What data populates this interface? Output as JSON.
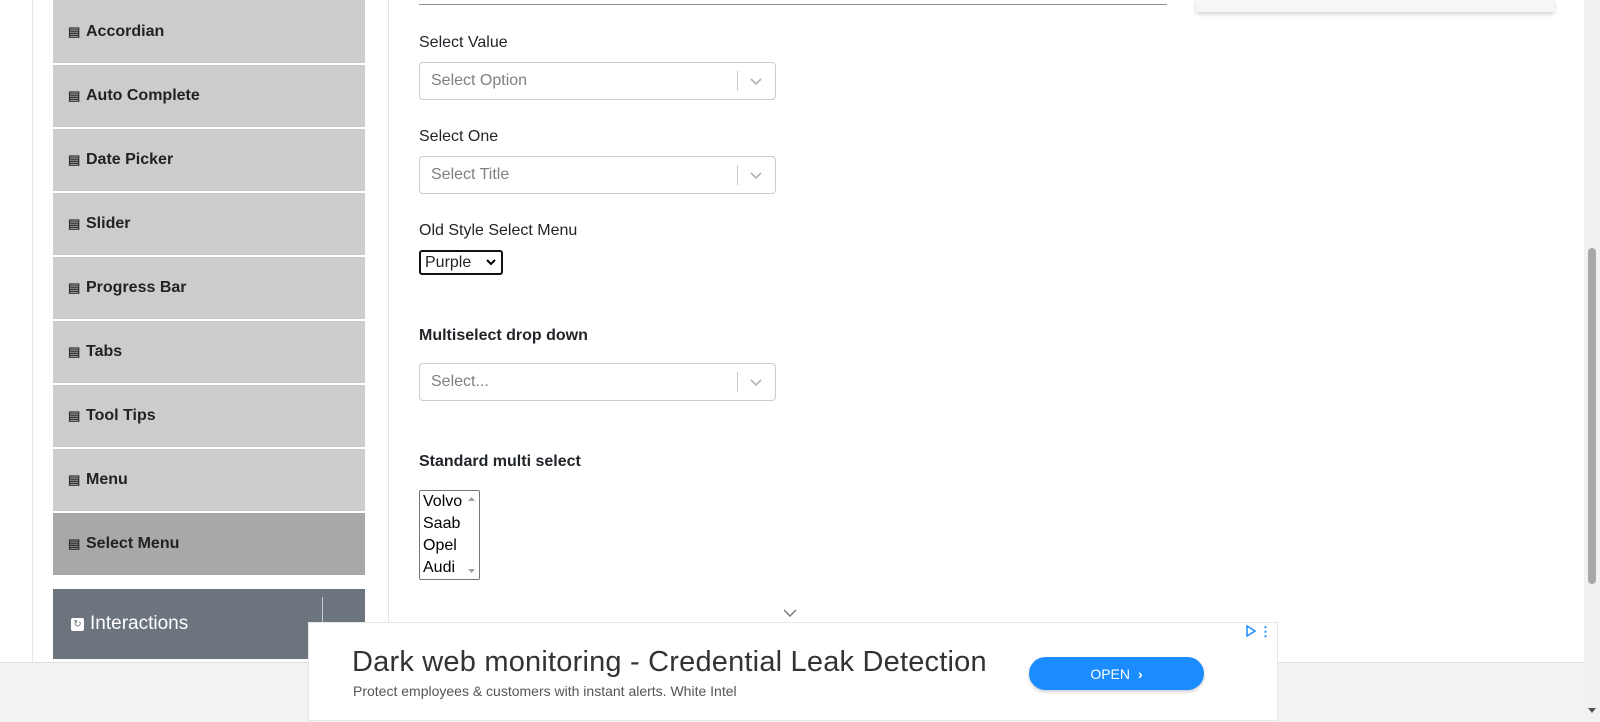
{
  "sidebar": {
    "items": [
      {
        "label": "Accordian",
        "icon": "html5-icon"
      },
      {
        "label": "Auto Complete",
        "icon": "html5-icon"
      },
      {
        "label": "Date Picker",
        "icon": "html5-icon"
      },
      {
        "label": "Slider",
        "icon": "html5-icon"
      },
      {
        "label": "Progress Bar",
        "icon": "html5-icon"
      },
      {
        "label": "Tabs",
        "icon": "html5-icon"
      },
      {
        "label": "Tool Tips",
        "icon": "html5-icon"
      },
      {
        "label": "Menu",
        "icon": "html5-icon"
      },
      {
        "label": "Select Menu",
        "icon": "html5-icon",
        "active": true
      }
    ],
    "group": {
      "label": "Interactions",
      "icon": "interactions-icon"
    }
  },
  "form": {
    "select_value": {
      "label": "Select Value",
      "placeholder": "Select Option"
    },
    "select_one": {
      "label": "Select One",
      "placeholder": "Select Title"
    },
    "old_style": {
      "label": "Old Style Select Menu",
      "value": "Purple"
    },
    "multiselect": {
      "label": "Multiselect drop down",
      "placeholder": "Select..."
    },
    "standard_multi": {
      "label": "Standard multi select",
      "options": [
        "Volvo",
        "Saab",
        "Opel",
        "Audi"
      ]
    }
  },
  "ad": {
    "headline": "Dark web monitoring - Credential Leak Detection",
    "subline": "Protect employees & customers with instant alerts. White Intel",
    "cta": "OPEN",
    "cta_arrow": "›",
    "menu": "⋮"
  },
  "colors": {
    "sidebar_item": "#cccccc",
    "sidebar_active": "#a8a8a8",
    "group_header": "#6c757d",
    "ad_button": "#1a8cff"
  }
}
